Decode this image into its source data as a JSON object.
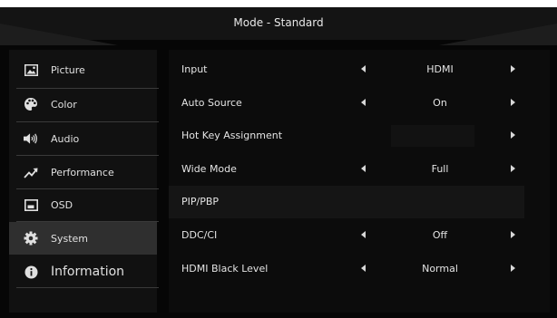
{
  "header": {
    "title": "Mode - Standard"
  },
  "sidebar": {
    "items": [
      {
        "label": "Picture",
        "icon": "picture-icon"
      },
      {
        "label": "Color",
        "icon": "palette-icon"
      },
      {
        "label": "Audio",
        "icon": "speaker-icon"
      },
      {
        "label": "Performance",
        "icon": "trend-up-icon"
      },
      {
        "label": "OSD",
        "icon": "osd-window-icon"
      },
      {
        "label": "System",
        "icon": "gear-icon",
        "selected": true
      },
      {
        "label": "Information",
        "icon": "info-icon"
      }
    ]
  },
  "settings": {
    "rows": [
      {
        "name": "Input",
        "value": "HDMI"
      },
      {
        "name": "Auto Source",
        "value": "On"
      },
      {
        "name": "Hot Key Assignment",
        "value": ""
      },
      {
        "name": "Wide Mode",
        "value": "Full"
      },
      {
        "name": "PIP/PBP",
        "value": ""
      },
      {
        "name": "DDC/CI",
        "value": "Off"
      },
      {
        "name": "HDMI Black Level",
        "value": "Normal"
      }
    ]
  },
  "colors": {
    "background": "#060606",
    "selected": "#2f2f2f",
    "text": "#e4e4e4"
  }
}
